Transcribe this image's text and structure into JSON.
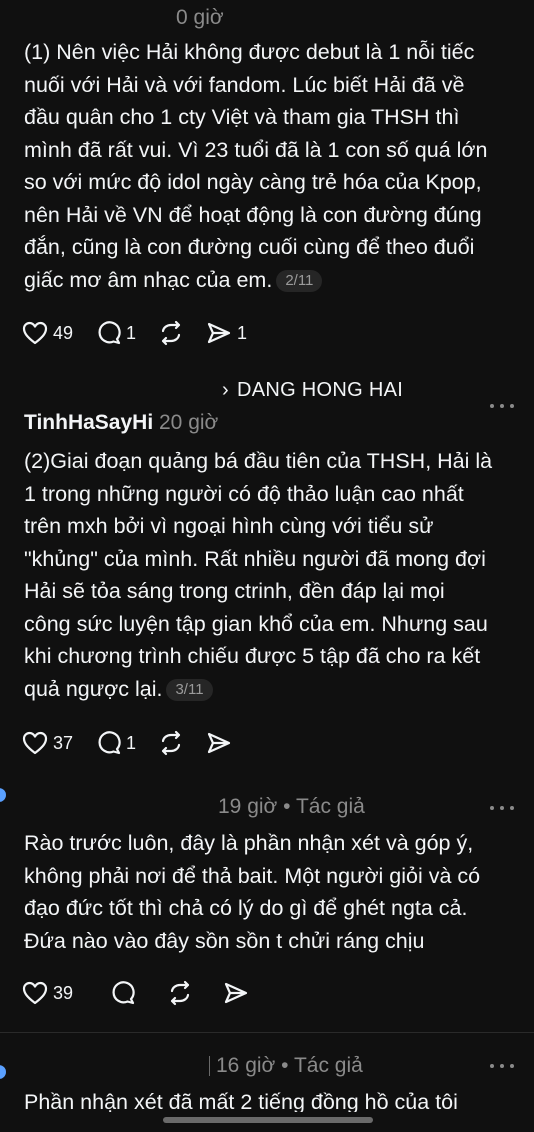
{
  "posts": [
    {
      "time": "0 giờ",
      "text": "(1) Nên việc Hải không được debut là 1 nỗi tiếc\nnuối với Hải và với fandom. Lúc biết Hải đã về\nđầu quân cho 1 cty Việt và tham gia THSH thì\nmình đã rất vui. Vì 23 tuổi đã là 1 con số quá lớn\nso với mức độ idol ngày càng trẻ hóa của Kpop,\nnên Hải về VN để hoạt động là con đường đúng\nđắn, cũng là con đường cuối cùng để theo đuổi\ngiấc mơ âm nhạc của em.",
      "page": "2/11",
      "likes": "49",
      "replies": "1",
      "shares": "1"
    },
    {
      "thread_label": "DANG HONG HAI",
      "author": "TinhHaSayHi",
      "time": "20 giờ",
      "text": "(2)Giai đoạn quảng bá đầu tiên của THSH, Hải là\n1 trong những người có độ thảo luận cao nhất\ntrên mxh bởi vì ngoại hình cùng với tiểu sử\n\"khủng\" của mình. Rất nhiều người đã mong đợi\nHải sẽ tỏa sáng trong ctrinh, đền đáp lại mọi\ncông sức luyện tập gian khổ của em. Nhưng sau\nkhi chương trình chiếu được 5 tập đã cho ra kết\nquả ngược lại.",
      "page": "3/11",
      "likes": "37",
      "replies": "1"
    },
    {
      "time_author": "19 giờ • Tác giả",
      "text": "Rào trước luôn, đây là phần nhận xét và góp ý,\nkhông phải nơi để thả bait. Một người giỏi và có\nđạo đức tốt thì chả có lý do gì để ghét ngta cả.\nĐứa nào vào đây sồn sồn t chửi ráng chịu",
      "likes": "39"
    },
    {
      "time_author": "16 giờ • Tác giả",
      "text": "Phần nhận xét đã mất 2 tiếng đồng hồ của tôi"
    }
  ],
  "colors": {
    "background": "#101010",
    "text": "#f3f5f7",
    "muted": "#8a8a8a"
  },
  "icons": [
    "heart-icon",
    "comment-icon",
    "repost-icon",
    "send-icon",
    "more-icon",
    "chevron-right-icon"
  ]
}
